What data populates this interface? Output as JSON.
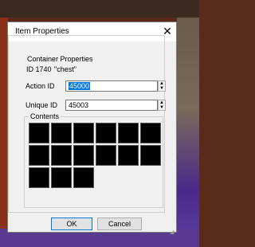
{
  "window": {
    "title": "Item Properties",
    "close_glyph": "✕"
  },
  "container": {
    "group_label": "Container Properties",
    "id_text": "ID 1740",
    "name_text": "\"chest\""
  },
  "fields": {
    "action_id_label": "Action ID",
    "action_id_value": "45000",
    "unique_id_label": "Unique ID",
    "unique_id_value": "45003"
  },
  "contents": {
    "label": "Contents",
    "slot_count": 15
  },
  "buttons": {
    "ok": "OK",
    "cancel": "Cancel"
  },
  "icons": {
    "close": "close-icon",
    "spin_up": "chevron-up-icon",
    "spin_down": "chevron-down-icon",
    "resize": "resize-grip-icon"
  }
}
